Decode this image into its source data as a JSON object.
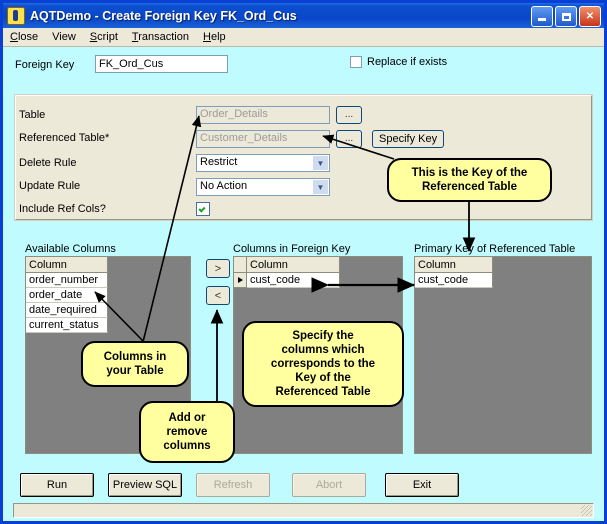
{
  "window": {
    "title": "AQTDemo - Create Foreign Key FK_Ord_Cus",
    "app_icon": "aqt-icon",
    "minimize_label": "Minimize",
    "maximize_label": "Maximize",
    "close_label": "Close"
  },
  "menu": {
    "items": [
      {
        "label": "Close",
        "accel": "C"
      },
      {
        "label": "View",
        "accel": ""
      },
      {
        "label": "Script",
        "accel": "S"
      },
      {
        "label": "Transaction",
        "accel": "T"
      },
      {
        "label": "Help",
        "accel": "H"
      }
    ]
  },
  "foreign_key": {
    "label": "Foreign Key",
    "value": "FK_Ord_Cus",
    "placeholder": "",
    "replace_if_exists_label": "Replace if exists",
    "replace_if_exists_checked": false
  },
  "properties": {
    "table": {
      "label": "Table",
      "value": "Order_Details",
      "browse_label": "..."
    },
    "referenced_table": {
      "label": "Referenced Table*",
      "value": "Customer_Details",
      "browse_label": "...",
      "specify_key_label": "Specify Key"
    },
    "delete_rule": {
      "label": "Delete Rule",
      "value": "Restrict"
    },
    "update_rule": {
      "label": "Update Rule",
      "value": "No Action"
    },
    "include_ref_cols": {
      "label": "Include Ref Cols?",
      "checked": true
    }
  },
  "lists": {
    "available": {
      "title": "Available Columns",
      "header": "Column",
      "rows": [
        "order_number",
        "order_date",
        "date_required",
        "current_status"
      ]
    },
    "in_foreign_key": {
      "title": "Columns in Foreign Key",
      "header": "Column",
      "rows": [
        "cust_code"
      ]
    },
    "primary_key": {
      "title": "Primary Key of Referenced Table",
      "header": "Column",
      "rows": [
        "cust_code"
      ]
    },
    "add_button_label": ">",
    "remove_button_label": "<"
  },
  "callouts": [
    {
      "id": "key-of-ref-table",
      "text": "This is the Key of the\nReferenced Table"
    },
    {
      "id": "columns-in-your-table",
      "text": "Columns in\nyour Table"
    },
    {
      "id": "specify-columns",
      "text": "Specify the\ncolumns which\ncorresponds to the\nKey of the\nReferenced Table"
    },
    {
      "id": "add-remove-columns",
      "text": "Add or\nremove\ncolumns"
    }
  ],
  "footer": {
    "buttons": [
      {
        "label": "Run",
        "enabled": true
      },
      {
        "label": "Preview SQL",
        "enabled": true
      },
      {
        "label": "Refresh",
        "enabled": false
      },
      {
        "label": "Abort",
        "enabled": false
      },
      {
        "label": "Exit",
        "enabled": true
      }
    ]
  },
  "status": {
    "text": ""
  },
  "colors": {
    "window_background": "#bffbff",
    "panel_background": "#ece9d8",
    "grid_background": "#808080",
    "callout_background": "#ffffa0",
    "title_gradient_start": "#1f6fe0",
    "title_gradient_end": "#0a46c8",
    "disabled_text": "#acaa9c",
    "readonly_text": "#9b9b9b"
  }
}
